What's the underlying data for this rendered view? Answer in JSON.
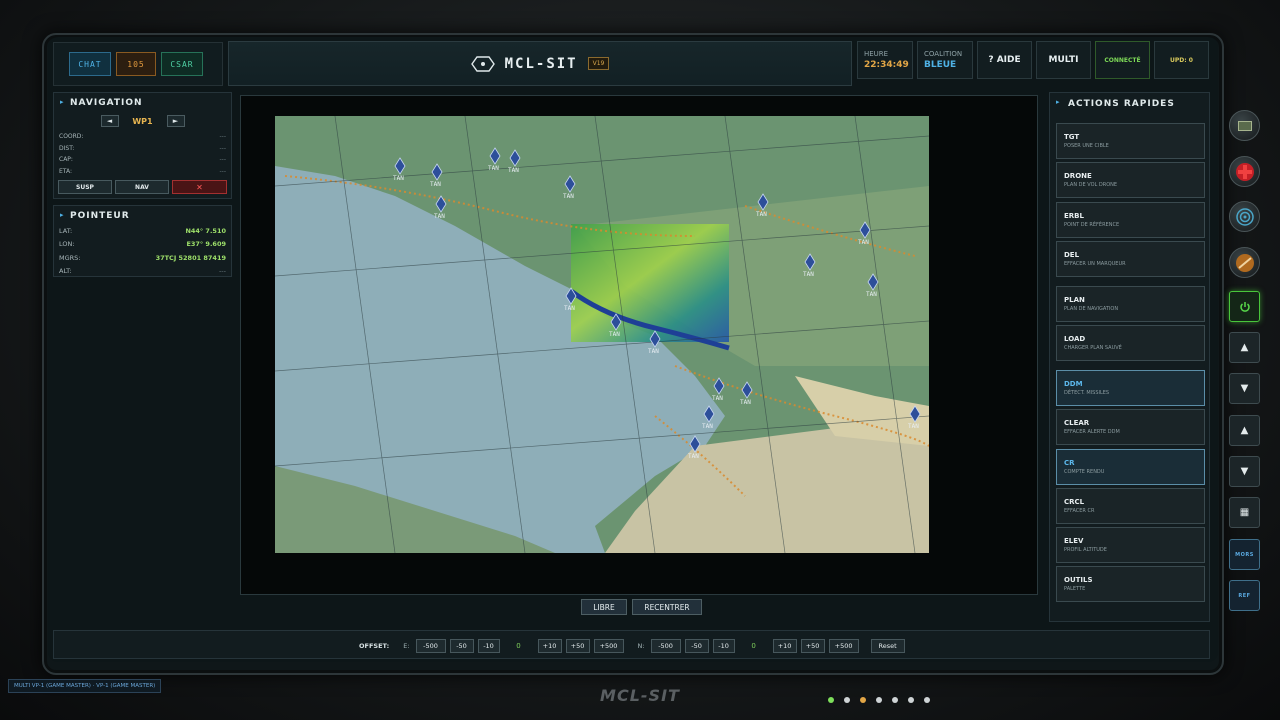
{
  "app": {
    "title": "MCL-SIT",
    "version": "V19",
    "footer_logo": "MCL-SIT"
  },
  "top_left": {
    "chat": "CHAT",
    "ios": "105",
    "csar": "CSAR"
  },
  "status": {
    "heure_label": "HEURE",
    "heure_value": "22:34:49",
    "coalition_label": "COALITION",
    "coalition_value": "BLEUE",
    "aide": "? AIDE",
    "multi": "MULTI",
    "connected": "CONNECTÉ",
    "upd": "UPD: 0"
  },
  "navigation": {
    "title": "NAVIGATION",
    "prev": "◄",
    "waypoint": "WP1",
    "next": "►",
    "rows": [
      {
        "k": "COORD:",
        "v": "---"
      },
      {
        "k": "DIST:",
        "v": "---"
      },
      {
        "k": "CAP:",
        "v": "---"
      },
      {
        "k": "ETA:",
        "v": "---"
      }
    ],
    "susp": "SUSP",
    "nav": "NAV",
    "delete": "✕"
  },
  "pointeur": {
    "title": "POINTEUR",
    "rows": [
      {
        "k": "LAT:",
        "v": "N44° 7.510"
      },
      {
        "k": "LON:",
        "v": "E37° 9.609"
      },
      {
        "k": "MGRS:",
        "v": "37TCJ 52801 87419"
      },
      {
        "k": "ALT:",
        "v": "---"
      }
    ]
  },
  "map": {
    "marker_label": "TAN",
    "libre": "LIBRE",
    "recentrer": "RECENTRER",
    "colors": {
      "sea": "#8fb0bb",
      "land": "#6e9673",
      "highland": "#c9c4a6",
      "accent": "#d98a2e"
    }
  },
  "actions": {
    "title": "ACTIONS RAPIDES",
    "items": [
      {
        "code": "TGT",
        "desc": "POSER UNE CIBLE"
      },
      {
        "code": "DRONE",
        "desc": "PLAN DE VOL DRONE"
      },
      {
        "code": "ERBL",
        "desc": "POINT DE RÉFÉRENCE"
      },
      {
        "code": "DEL",
        "desc": "EFFACER UN MARQUEUR"
      },
      {
        "code": "PLAN",
        "desc": "PLAN DE NAVIGATION"
      },
      {
        "code": "LOAD",
        "desc": "CHARGER PLAN SAUVÉ"
      },
      {
        "code": "DDM",
        "desc": "DÉTECT. MISSILES"
      },
      {
        "code": "CLEAR",
        "desc": "EFFACER ALERTE DDM"
      },
      {
        "code": "CR",
        "desc": "COMPTE RENDU"
      },
      {
        "code": "CRCL",
        "desc": "EFFACER CR"
      },
      {
        "code": "ELEV",
        "desc": "PROFIL ALTITUDE"
      },
      {
        "code": "OUTILS",
        "desc": "PALETTE"
      }
    ]
  },
  "side": {
    "mors": "MORS",
    "ref": "REF"
  },
  "offset": {
    "label": "OFFSET:",
    "e_axis": "E:",
    "n_axis": "N:",
    "e_value": "0",
    "n_value": "0",
    "minus500": "-500",
    "minus50": "-50",
    "minus10": "-10",
    "plus10": "+10",
    "plus50": "+50",
    "plus500": "+500",
    "reset": "Reset"
  },
  "footer": {
    "status_chip": "MULTI VP-1 (GAME MASTER) · VP-1 (GAME MASTER)"
  }
}
